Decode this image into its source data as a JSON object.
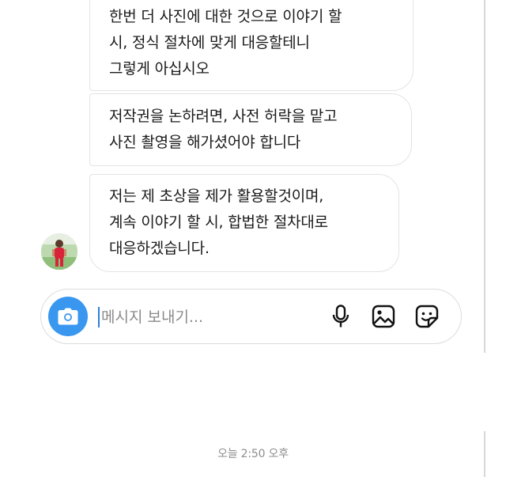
{
  "messages": [
    {
      "lines": [
        "한번 더 사진에 대한 것으로 이야기 할",
        "시, 정식 절차에 맞게 대응할테니",
        "그렇게 아십시오"
      ]
    },
    {
      "lines": [
        "저작권을 논하려면, 사전 허락을 맡고",
        "사진 촬영을 해가셨어야 합니다"
      ]
    },
    {
      "lines": [
        "저는 제 초상을 제가 활용할것이며,",
        "계속 이야기 할 시, 합법한 절차대로",
        "대응하겠습니다."
      ]
    }
  ],
  "composer": {
    "placeholder": "메시지 보내기...",
    "accent_color": "#3a97f0"
  },
  "icons": [
    "camera-icon",
    "microphone-icon",
    "gallery-icon",
    "sticker-icon"
  ],
  "timestamp": "오늘 2:50 오후"
}
